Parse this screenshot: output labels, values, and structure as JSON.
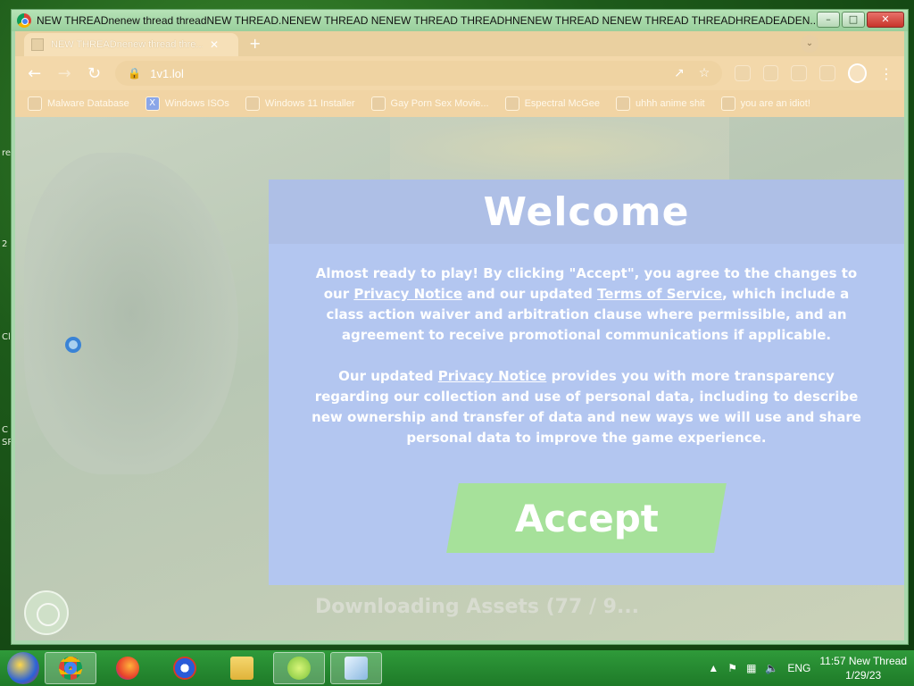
{
  "window": {
    "title": "NEW THREADnenew thread threadNEW THREAD.NENEW THREAD NENEW THREAD THREADHNENEW THREAD NENEW THREAD THREADHREADEADEN...",
    "minimize": "–",
    "maximize": "□",
    "close": "✕"
  },
  "browser": {
    "tab_title": "NEW THREADnenew thread thre...",
    "tab_close": "✕",
    "new_tab": "+",
    "back": "←",
    "forward": "→",
    "reload": "↻",
    "url": "1v1.lol",
    "menu": "⋮",
    "bookmarks": [
      {
        "label": "Malware Database",
        "icon": "folder-icon"
      },
      {
        "label": "Windows ISOs",
        "icon": "x-icon"
      },
      {
        "label": "Windows 11 Installer",
        "icon": "installer-icon"
      },
      {
        "label": "Gay Porn Sex Movie...",
        "icon": "site-icon"
      },
      {
        "label": "Espectral McGee",
        "icon": "site-icon"
      },
      {
        "label": "uhhh anime shit",
        "icon": "site-icon"
      },
      {
        "label": "you are an idiot!",
        "icon": "flag-icon"
      }
    ]
  },
  "modal": {
    "title": "Welcome",
    "p1_pre": "Almost ready to play! By clicking \"Accept\", you agree to the changes to our ",
    "privacy_link": "Privacy Notice",
    "p1_mid": " and our updated ",
    "terms_link": "Terms of Service",
    "p1_post": ", which include a class action waiver and arbitration clause where permissible, and an agreement to receive promotional communications if applicable.",
    "p2_pre": "Our updated ",
    "privacy_link2": "Privacy Notice",
    "p2_post": " provides you with more transparency regarding our collection and use of personal data, including to describe new ownership and transfer of data and new ways we will use and share personal data to improve the game experience.",
    "accept": "Accept"
  },
  "page": {
    "loading": "Downloading Assets (77 / 9..."
  },
  "taskbar": {
    "lang": "ENG",
    "time": "11:57 New Thread",
    "date": "1/29/23"
  }
}
